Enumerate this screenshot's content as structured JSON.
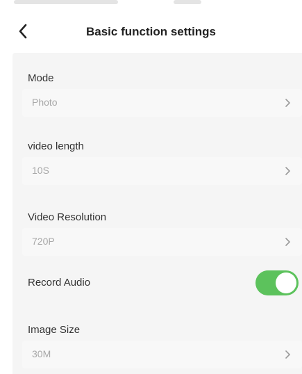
{
  "header": {
    "title": "Basic function settings",
    "back_icon": "chevron-left-icon"
  },
  "settings": {
    "mode": {
      "label": "Mode",
      "value": "Photo"
    },
    "video_length": {
      "label": "video length",
      "value": "10S"
    },
    "video_resolution": {
      "label": "Video Resolution",
      "value": "720P"
    },
    "record_audio": {
      "label": "Record Audio",
      "enabled": true
    },
    "image_size": {
      "label": "Image Size",
      "value": "30M"
    }
  },
  "colors": {
    "toggle_on": "#5cc25c",
    "chevron": "#9a9a9a"
  }
}
